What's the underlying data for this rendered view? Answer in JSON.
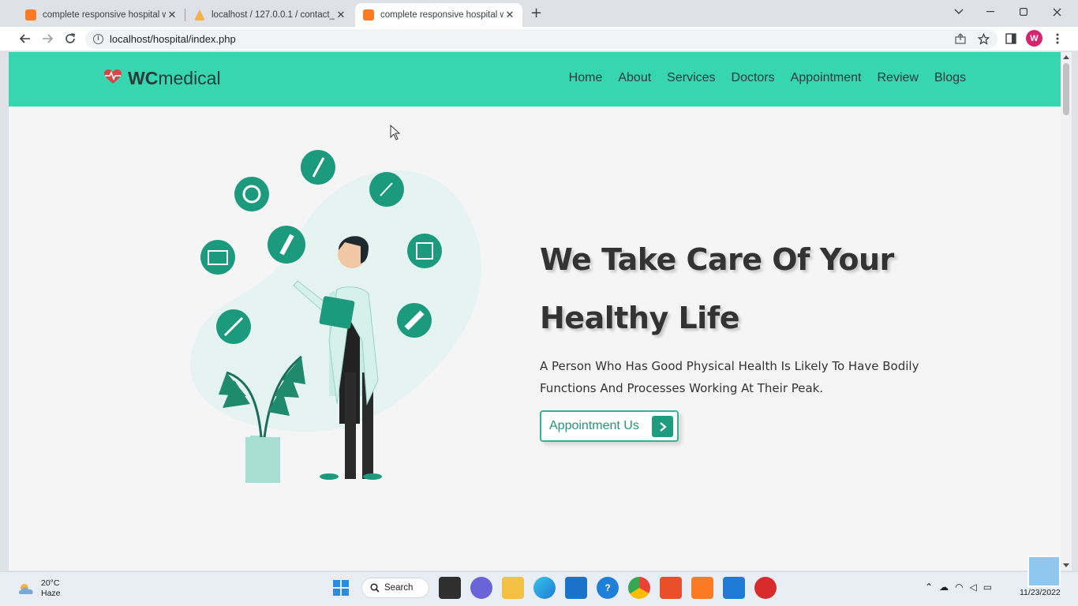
{
  "browser": {
    "tabs": [
      {
        "title": "complete responsive hospital w",
        "active": false,
        "favicon": "xampp-icon"
      },
      {
        "title": "localhost / 127.0.0.1 / contact_d",
        "active": false,
        "favicon": "phpmyadmin-icon"
      },
      {
        "title": "complete responsive hospital w",
        "active": true,
        "favicon": "xampp-icon"
      }
    ],
    "new_tab": "+",
    "url": "localhost/hospital/index.php",
    "profile_initial": "W"
  },
  "site": {
    "brand_bold": "WC",
    "brand_rest": "medical",
    "brand_color": "#35d6b0",
    "nav": [
      "Home",
      "About",
      "Services",
      "Doctors",
      "Appointment",
      "Review",
      "Blogs"
    ],
    "hero": {
      "title_line1": "We Take Care Of Your",
      "title_line2": "Healthy Life",
      "subtitle_line1": "A Person Who Has Good Physical Health Is Likely To Have Bodily",
      "subtitle_line2": "Functions And Processes Working At Their Peak.",
      "cta_label": "Appointment Us"
    }
  },
  "taskbar": {
    "weather_temp": "20°C",
    "weather_desc": "Haze",
    "search_label": "Search",
    "date": "11/23/2022"
  }
}
